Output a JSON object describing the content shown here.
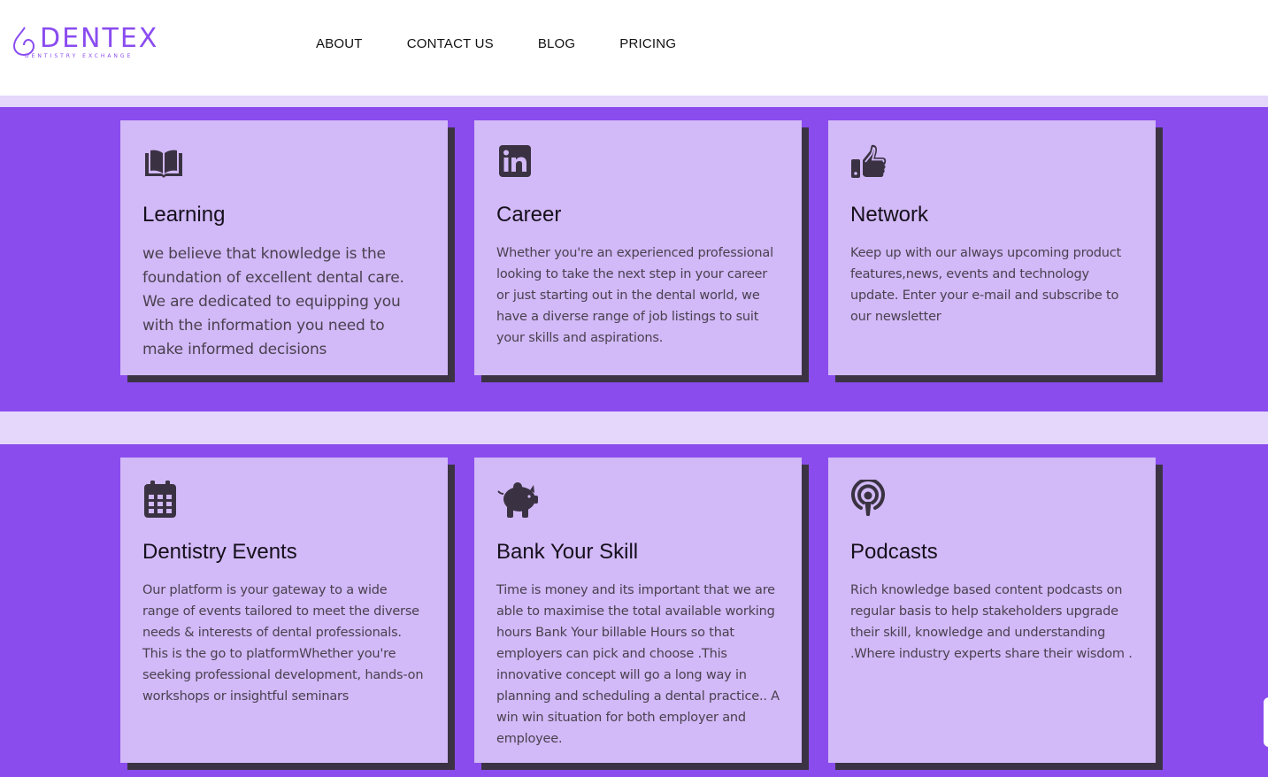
{
  "brand": {
    "name": "DENTEX",
    "tagline": "DENTISTRY EXCHANGE",
    "color": "#8a4cf0"
  },
  "nav": {
    "items": [
      {
        "label": "ABOUT"
      },
      {
        "label": "CONTACT US"
      },
      {
        "label": "BLOG"
      },
      {
        "label": "PRICING"
      }
    ]
  },
  "colors": {
    "accent_purple": "#8a4ced",
    "card_bg": "#d2b9f7",
    "card_shadow": "#3b3344",
    "band_light": "#e4d7fb"
  },
  "features": [
    {
      "icon": "open-book-icon",
      "title": "Learning",
      "text": "we believe that knowledge is the foundation of excellent dental care. We are dedicated to equipping you with the information you need to make informed decisions"
    },
    {
      "icon": "linkedin-icon",
      "title": "Career",
      "text": "Whether you're an experienced professional looking to take the next step in your career or just starting out in the dental world, we have a diverse range of job listings to suit your skills and aspirations."
    },
    {
      "icon": "thumbs-up-icon",
      "title": "Network",
      "text": "Keep up with our always upcoming product features,news, events and technology update. Enter your e-mail and subscribe to our newsletter"
    },
    {
      "icon": "calendar-icon",
      "title": "Dentistry Events",
      "text": "Our platform is your gateway to a wide range of events tailored to meet the diverse needs & interests of dental professionals. This is the go to platformWhether you're seeking professional development, hands-on workshops or insightful seminars"
    },
    {
      "icon": "piggy-bank-icon",
      "title": "Bank Your Skill",
      "text": "Time is money and its important that we are able to maximise the total available working hours Bank Your billable Hours so that employers can pick and choose .This innovative concept will go a long way in planning and scheduling a dental practice.. A win win situation for both employer and employee."
    },
    {
      "icon": "podcast-icon",
      "title": "Podcasts",
      "text": "Rich knowledge based content podcasts on regular basis to help stakeholders upgrade their skill, knowledge and understanding .Where industry experts share their wisdom ."
    }
  ]
}
